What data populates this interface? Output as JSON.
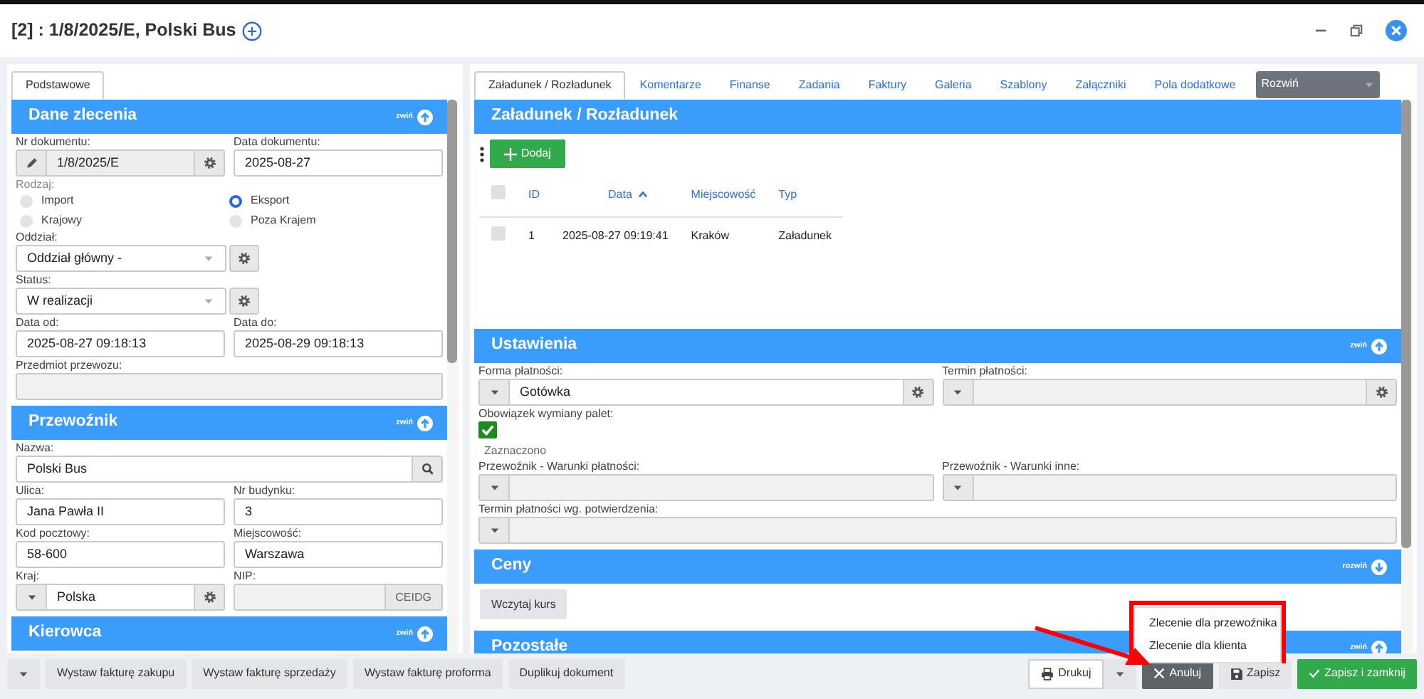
{
  "window": {
    "title": "[2] : 1/8/2025/E, Polski Bus"
  },
  "left_panel": {
    "tabs": [
      {
        "label": "Podstawowe",
        "selected": true
      }
    ],
    "sections": [
      {
        "title": "Dane zlecenia",
        "toggle": "zwiń",
        "expanded": true,
        "rows": [
          [
            {
              "kind": "locked",
              "label": "Nr dokumentu:",
              "value": "1/8/2025/E",
              "disabled": true
            },
            {
              "kind": "text",
              "label": "Data dokumentu:",
              "value": "2025-08-27",
              "disabled": false
            }
          ],
          [
            {
              "kind": "radios",
              "label": "Rodzaj:",
              "options": [
                {
                  "label": "Import",
                  "selected": false
                },
                {
                  "label": "Eksport",
                  "selected": true
                },
                {
                  "label": "Krajowy",
                  "selected": false
                },
                {
                  "label": "Poza Krajem",
                  "selected": false
                }
              ]
            }
          ],
          [
            {
              "kind": "select",
              "label": "Oddział:",
              "value": "Oddział główny -",
              "disabled": false
            }
          ],
          [
            {
              "kind": "select",
              "label": "Status:",
              "value": "W realizacji",
              "disabled": false
            }
          ],
          [
            {
              "kind": "text",
              "label": "Data od:",
              "value": "2025-08-27 09:18:13",
              "disabled": false
            },
            {
              "kind": "text",
              "label": "Data do:",
              "value": "2025-08-29 09:18:13",
              "disabled": false
            }
          ],
          [
            {
              "kind": "text",
              "label": "Przedmiot przewozu:",
              "disabled": true
            }
          ]
        ]
      },
      {
        "title": "Przewoźnik",
        "toggle": "zwiń",
        "expanded": true,
        "rows": [
          [
            {
              "kind": "search",
              "label": "Nazwa:",
              "value": "Polski Bus",
              "disabled": false
            }
          ],
          [
            {
              "kind": "text",
              "label": "Ulica:",
              "value": "Jana Pawła II",
              "disabled": false
            },
            {
              "kind": "text",
              "label": "Nr budynku:",
              "value": "3",
              "disabled": false
            }
          ],
          [
            {
              "kind": "text",
              "label": "Kod pocztowy:",
              "value": "58-600",
              "disabled": false
            },
            {
              "kind": "text",
              "label": "Miejscowość:",
              "value": "Warszawa",
              "disabled": false
            }
          ],
          [
            {
              "kind": "combo",
              "label": "Kraj:",
              "value": "Polska",
              "disabled": false
            },
            {
              "kind": "addon",
              "label": "NIP:",
              "addon": "CEIDG",
              "disabled": true
            }
          ]
        ]
      },
      {
        "title": "Kierowca",
        "toggle": "zwiń",
        "expanded": true
      }
    ]
  },
  "right_panel": {
    "tabs": [
      {
        "label": "Załadunek / Rozładunek",
        "selected": true
      },
      {
        "label": "Komentarze",
        "selected": false
      },
      {
        "label": "Finanse",
        "selected": false
      },
      {
        "label": "Zadania",
        "selected": false
      },
      {
        "label": "Faktury",
        "selected": false
      },
      {
        "label": "Galeria",
        "selected": false
      },
      {
        "label": "Szablony",
        "selected": false
      },
      {
        "label": "Załączniki",
        "selected": false
      },
      {
        "label": "Pola dodatkowe",
        "selected": false
      }
    ],
    "more_menu": {
      "label": "Rozwiń"
    },
    "loading": {
      "title": "Załadunek / Rozładunek",
      "add_button": "Dodaj",
      "all_checked": false,
      "columns": [
        {
          "label": "ID",
          "sorted": false
        },
        {
          "label": "Data",
          "sorted": true
        },
        {
          "label": "Miejscowość",
          "sorted": false
        },
        {
          "label": "Typ",
          "sorted": false
        }
      ],
      "rows": [
        {
          "checked": false,
          "cells": [
            "1",
            "2025-08-27 09:19:41",
            "Kraków",
            "Załadunek"
          ]
        }
      ]
    },
    "sections": [
      {
        "title": "Ustawienia",
        "toggle": "zwiń",
        "expanded": true,
        "rows": [
          [
            {
              "kind": "combo",
              "label": "Forma płatności:",
              "value": "Gotówka",
              "disabled": false
            },
            {
              "kind": "combo",
              "label": "Termin płatności:",
              "disabled": true
            }
          ],
          [
            {
              "kind": "checkbox",
              "label": "Obowiązek wymiany palet:",
              "checked": true,
              "caption": "Zaznaczono"
            }
          ],
          [
            {
              "kind": "dropdown",
              "label": "Przewoźnik - Warunki płatności:",
              "disabled": true
            },
            {
              "kind": "dropdown",
              "label": "Przewoźnik - Warunki inne:",
              "disabled": true
            }
          ],
          [
            {
              "kind": "dropdown",
              "label": "Termin płatności wg. potwierdzenia:",
              "disabled": true
            }
          ]
        ]
      },
      {
        "title": "Ceny",
        "toggle": "rozwiń",
        "expanded": false,
        "button": "Wczytaj kurs"
      },
      {
        "title": "Pozostałe",
        "toggle": "zwiń",
        "expanded": true
      }
    ]
  },
  "footer": {
    "left_buttons": [
      "Wystaw fakturę zakupu",
      "Wystaw fakturę sprzedaży",
      "Wystaw fakturę proforma",
      "Duplikuj dokument"
    ],
    "print": "Drukuj",
    "cancel": "Anuluj",
    "save": "Zapisz",
    "save_close": "Zapisz i zamknij"
  },
  "print_menu": {
    "items": [
      "Zlecenie dla przewoźnika",
      "Zlecenie dla klienta"
    ]
  }
}
